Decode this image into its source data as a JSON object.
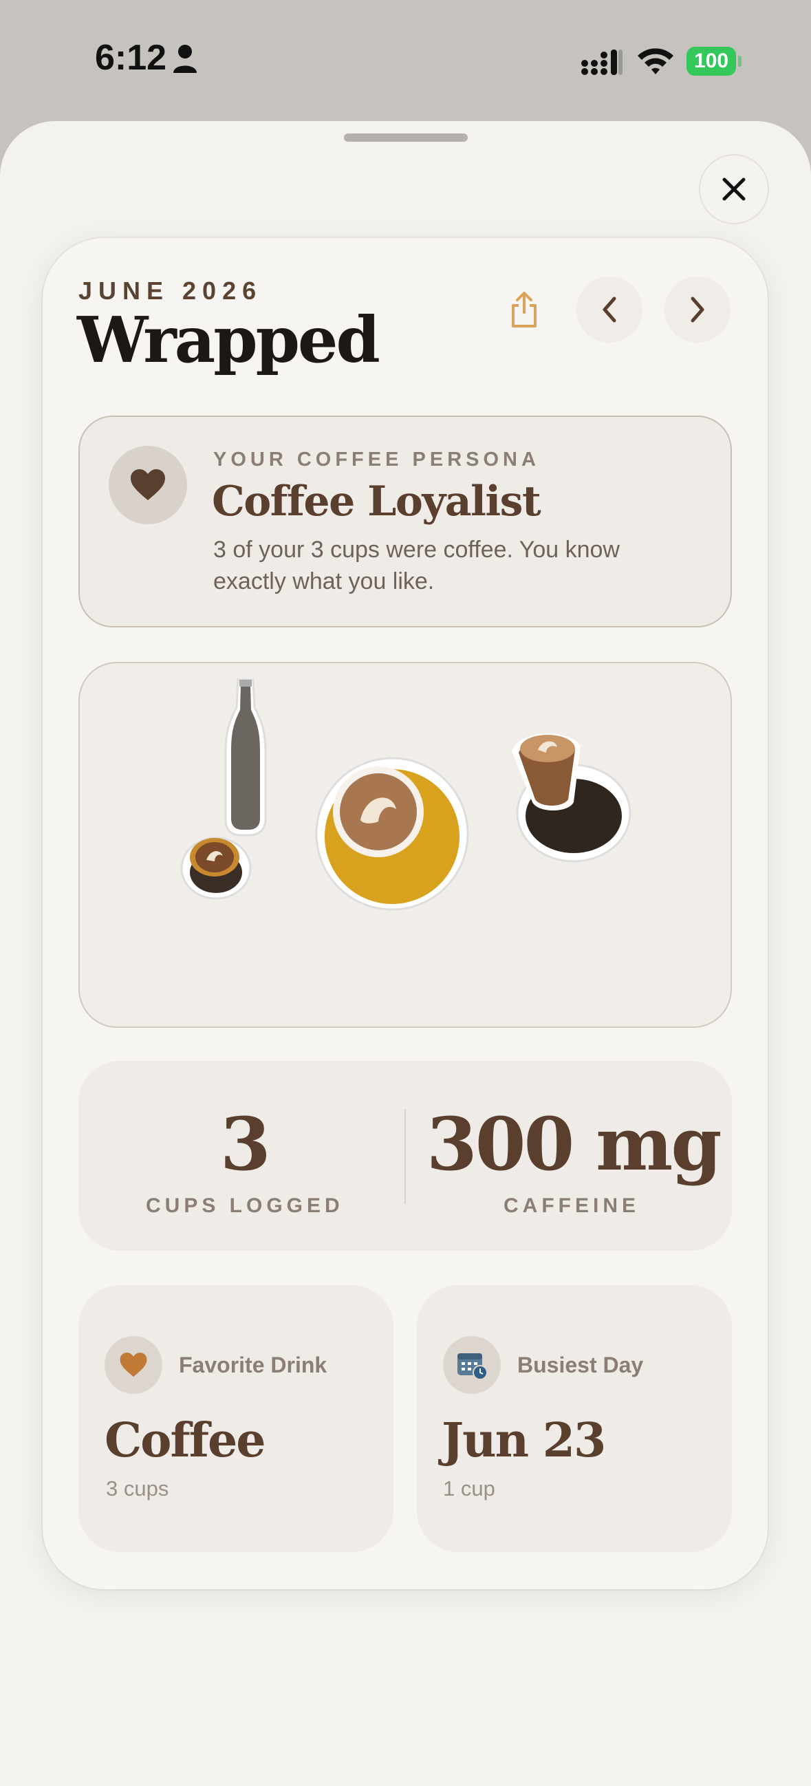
{
  "status_bar": {
    "time": "6:12",
    "battery": "100"
  },
  "wrapped": {
    "eyebrow": "JUNE 2026",
    "title": "Wrapped"
  },
  "persona": {
    "label": "YOUR COFFEE PERSONA",
    "name": "Coffee Loyalist",
    "description": "3 of your 3 cups were coffee. You know exactly what you like."
  },
  "stats": {
    "cups_value": "3",
    "cups_label": "CUPS LOGGED",
    "caffeine_value": "300 mg",
    "caffeine_label": "CAFFEINE"
  },
  "favorite": {
    "label": "Favorite Drink",
    "value": "Coffee",
    "sub": "3 cups"
  },
  "busiest": {
    "label": "Busiest Day",
    "value": "Jun 23",
    "sub": "1 cup"
  },
  "colors": {
    "accent": "#5b3f2e",
    "battery": "#34c759",
    "share": "#d9a35a"
  }
}
